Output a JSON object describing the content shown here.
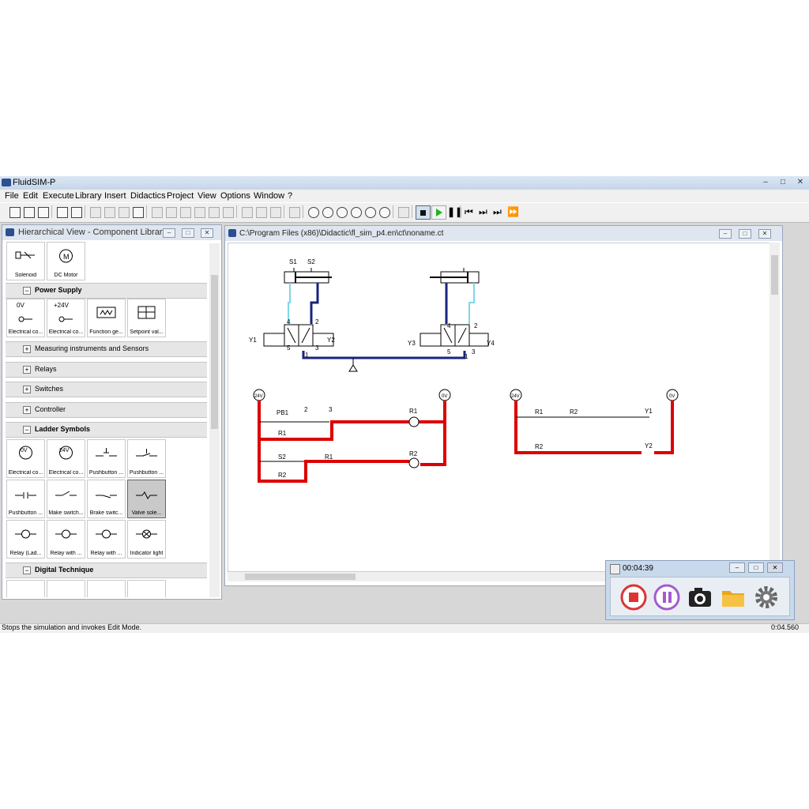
{
  "app": {
    "title": "FluidSIM-P"
  },
  "window_controls": {
    "minimize": "–",
    "maximize": "□",
    "close": "✕"
  },
  "menu": [
    "File",
    "Edit",
    "Execute",
    "Library",
    "Insert",
    "Didactics",
    "Project",
    "View",
    "Options",
    "Window",
    "?"
  ],
  "toolbar": {
    "icons": [
      "new-icon",
      "open-icon",
      "save-icon",
      "print-preview-icon",
      "print-icon",
      "undo-icon",
      "cut-icon",
      "copy-icon",
      "paste-icon",
      "align-left-icon",
      "align-center-icon",
      "align-right-icon",
      "align-top-icon",
      "align-middle-icon",
      "align-bottom-icon",
      "rotate-icon",
      "flip-h-icon",
      "flip-v-icon",
      "grid-icon",
      "zoom-fit-icon",
      "zoom-window-icon",
      "zoom-select-icon",
      "zoom-prev-icon",
      "zoom-in-icon",
      "zoom-out-icon",
      "check-icon",
      "stop-icon",
      "play-icon",
      "pause-icon",
      "reset-icon",
      "single-step-icon",
      "step-to-icon",
      "fast-forward-icon"
    ],
    "active": "stop-icon"
  },
  "library_panel": {
    "title": "Hierarchical View - Component Library",
    "top_tiles": [
      {
        "label": "Solenoid"
      },
      {
        "label": "DC Motor"
      }
    ],
    "groups": [
      {
        "name": "Power Supply",
        "expanded": true,
        "bold": true,
        "tiles": [
          {
            "label": "Electrical co...",
            "text": "0V"
          },
          {
            "label": "Electrical co...",
            "text": "+24V"
          },
          {
            "label": "Function ge..."
          },
          {
            "label": "Setpoint val..."
          }
        ]
      },
      {
        "name": "Measuring instruments and Sensors",
        "expanded": false
      },
      {
        "name": "Relays",
        "expanded": false
      },
      {
        "name": "Switches",
        "expanded": false
      },
      {
        "name": "Controller",
        "expanded": false
      },
      {
        "name": "Ladder Symbols",
        "expanded": true,
        "bold": true,
        "tiles": [
          {
            "label": "Electrical co...",
            "text": "0V"
          },
          {
            "label": "Electrical co...",
            "text": "24V"
          },
          {
            "label": "Pushbutton ..."
          },
          {
            "label": "Pushbutton ..."
          },
          {
            "label": "Pushbutton ..."
          },
          {
            "label": "Make switch..."
          },
          {
            "label": "Brake switc..."
          },
          {
            "label": "Valve sole...",
            "selected": true
          },
          {
            "label": "Relay (Lad..."
          },
          {
            "label": "Relay with ..."
          },
          {
            "label": "Relay with ..."
          },
          {
            "label": "Indicator light"
          }
        ]
      },
      {
        "name": "Digital Technique",
        "expanded": true,
        "bold": true
      }
    ]
  },
  "document": {
    "title": "C:\\Program Files (x86)\\Didactic\\fl_sim_p4.en\\ct\\noname.ct"
  },
  "circuit_labels": {
    "S1": "S1",
    "S2": "S2",
    "Y1": "Y1",
    "Y2": "Y2",
    "Y3": "Y3",
    "Y4": "Y4",
    "port4": "4",
    "port2": "2",
    "port5": "5",
    "port3": "3",
    "port1": "1",
    "v24": "24V",
    "v0": "0V",
    "PB1": "PB1",
    "R1": "R1",
    "R2": "R2",
    "n2": "2",
    "n3": "3",
    "S2b": "S2"
  },
  "status_bar": {
    "message": "Stops the simulation and invokes Edit Mode.",
    "time": "0:04.560"
  },
  "recorder": {
    "timer": "00:04:39",
    "buttons": [
      "record-stop-icon",
      "record-pause-icon",
      "camera-icon",
      "folder-icon",
      "settings-icon"
    ]
  },
  "colors": {
    "live_wire": "#dd0000",
    "pressure_line": "#1a237e",
    "exhaust_line": "#7fd6e8",
    "panel_title": "#dfe6ef"
  }
}
